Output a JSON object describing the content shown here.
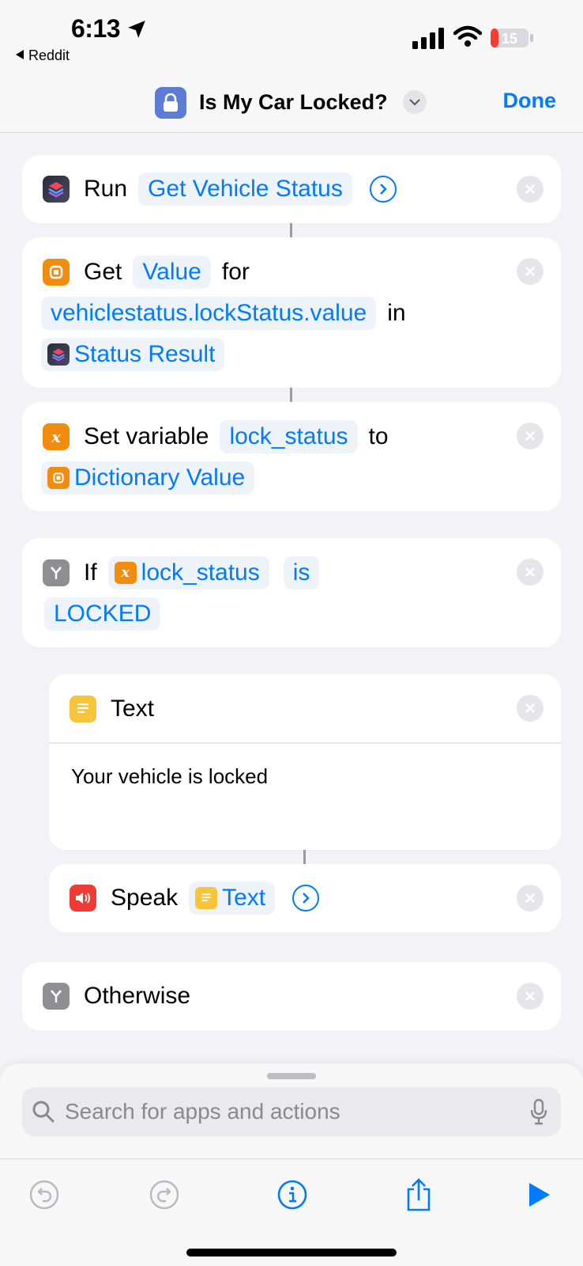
{
  "status_bar": {
    "time": "6:13",
    "back_app": "Reddit",
    "battery_level": "15"
  },
  "nav": {
    "title": "Is My Car Locked?",
    "done_label": "Done"
  },
  "actions": {
    "run": {
      "label": "Run",
      "shortcut": "Get Vehicle Status"
    },
    "get": {
      "label": "Get",
      "token": "Value",
      "for": "for",
      "key": "vehiclestatus.lockStatus.value",
      "in": "in",
      "source": "Status Result"
    },
    "set_variable": {
      "label": "Set variable",
      "name": "lock_status",
      "to": "to",
      "value": "Dictionary Value"
    },
    "if": {
      "label": "If",
      "variable": "lock_status",
      "operator": "is",
      "value": "LOCKED"
    },
    "text": {
      "label": "Text",
      "content": "Your vehicle is locked"
    },
    "speak": {
      "label": "Speak",
      "token": "Text"
    },
    "otherwise": {
      "label": "Otherwise"
    }
  },
  "search": {
    "placeholder": "Search for apps and actions"
  },
  "colors": {
    "accent": "#007AFF",
    "background": "#F2F2F7",
    "orange": "#F28C0F",
    "red": "#EF3B36",
    "yellow": "#F8C53A"
  }
}
